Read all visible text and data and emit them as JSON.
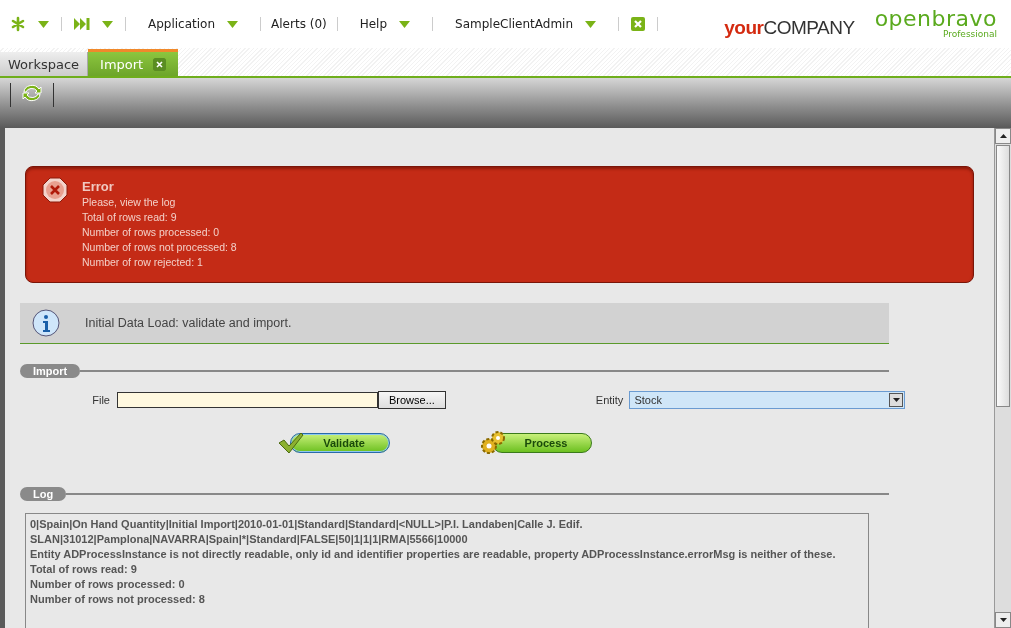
{
  "menu": [
    {
      "label": "Application",
      "dropdown": true
    },
    {
      "label": "Alerts (0)",
      "dropdown": false
    },
    {
      "label": "Help",
      "dropdown": true
    },
    {
      "label": "SampleClientAdmin",
      "dropdown": true
    }
  ],
  "logos": {
    "company_part1": "your",
    "company_part2": "COMPANY",
    "brand": "openbravo",
    "edition": "Professional"
  },
  "tabs": [
    {
      "label": "Workspace",
      "selected": false,
      "closable": false
    },
    {
      "label": "Import",
      "selected": true,
      "closable": true
    }
  ],
  "error": {
    "title": "Error",
    "lines": [
      "Please, view the log",
      "Total of rows read: 9",
      "Number of rows processed: 0",
      "Number of rows not processed: 8",
      "Number of row rejected: 1"
    ]
  },
  "info": {
    "text": "Initial Data Load: validate and import."
  },
  "import_section": {
    "title": "Import",
    "file_label": "File",
    "browse": "Browse...",
    "entity_label": "Entity",
    "entity_value": "Stock",
    "validate": "Validate",
    "process": "Process"
  },
  "log": {
    "title": "Log",
    "lines": [
      "0|Spain|On Hand Quantity|Initial Import|2010-01-01|Standard|Standard|<NULL>|P.I. Landaben|Calle J. Edif.",
      "SLAN|31012|Pamplona|NAVARRA|Spain|*|Standard|FALSE|50|1|1|1|RMA|5566|10000",
      "Entity ADProcessInstance is not directly readable, only id and identifier properties are readable, property ADProcessInstance.errorMsg is neither of these.",
      "Total of rows read: 9",
      "Number of rows processed: 0",
      "Number of rows not processed: 8"
    ]
  }
}
